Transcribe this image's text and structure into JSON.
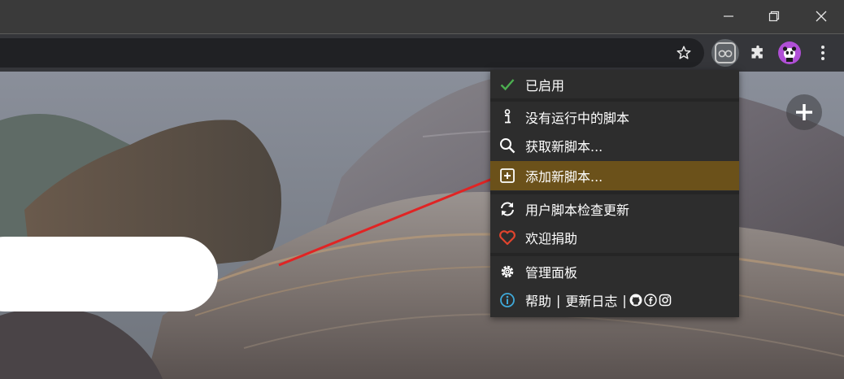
{
  "window": {
    "minimize_icon": "minimize-icon",
    "restore_icon": "restore-icon",
    "close_icon": "close-icon"
  },
  "toolbar": {
    "bookmark_icon": "star-outline-icon",
    "extension_icon": "tampermonkey-icon",
    "puzzle_icon": "puzzle-icon",
    "avatar_icon": "panda-avatar-icon",
    "menu_icon": "kebab-menu-icon"
  },
  "menu": {
    "enabled_label": "已启用",
    "no_scripts_label": "没有运行中的脚本",
    "get_scripts_label": "获取新脚本...",
    "add_script_label": "添加新脚本...",
    "check_updates_label": "用户脚本检查更新",
    "donate_label": "欢迎捐助",
    "dashboard_label": "管理面板",
    "footer": {
      "help_label": "帮助",
      "separator1": "|",
      "changelog_label": "更新日志",
      "separator2": "|"
    }
  },
  "colors": {
    "check_green": "#4caf50",
    "heart_red": "#e0442d",
    "info_blue": "#3fa9d9",
    "highlight": "#6b511a",
    "arrow_red": "#e02424"
  }
}
